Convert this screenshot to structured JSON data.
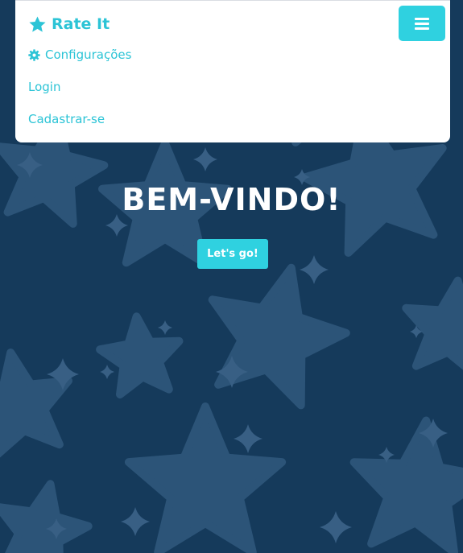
{
  "brand": {
    "name": "Rate It",
    "icon": "star-icon"
  },
  "navbar": {
    "toggle_icon": "hamburger-icon",
    "links": [
      {
        "label": "Configurações",
        "icon": "gear-icon"
      },
      {
        "label": "Login"
      },
      {
        "label": "Cadastrar-se"
      }
    ]
  },
  "hero": {
    "title": "BEM-VINDO!",
    "cta_label": "Let's go!"
  },
  "colors": {
    "background": "#153a5b",
    "star_pattern": "#2c5478",
    "accent": "#2fd1e0",
    "link": "#2cc4d6",
    "navbar_bg": "#ffffff",
    "title_text": "#ffffff"
  }
}
